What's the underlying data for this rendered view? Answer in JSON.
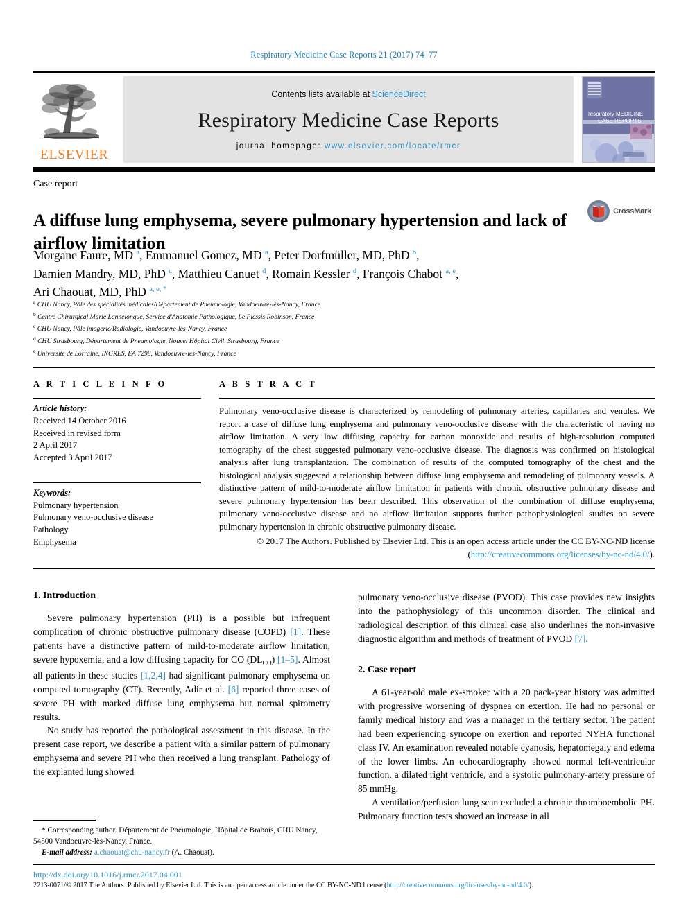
{
  "running_head": "Respiratory Medicine Case Reports 21 (2017) 74–77",
  "masthead": {
    "publisher": "ELSEVIER",
    "contents_prefix": "Contents lists available at ",
    "contents_link": "ScienceDirect",
    "journal_title": "Respiratory Medicine Case Reports",
    "homepage_prefix": "journal homepage: ",
    "homepage_url": "www.elsevier.com/locate/rmcr",
    "cover_line1": "respiratory MEDICINE",
    "cover_line2": "CASE REPORTS"
  },
  "article": {
    "type": "Case report",
    "title": "A diffuse lung emphysema, severe pulmonary hypertension and lack of airflow limitation",
    "crossmark_label": "CrossMark"
  },
  "authors_html": "Morgane Faure, MD <sup>a</sup>, Emmanuel Gomez, MD <sup>a</sup>, Peter Dorfmüller, MD, PhD <sup>b</sup>,<br>Damien Mandry, MD, PhD <sup>c</sup>, Matthieu Canuet <sup>d</sup>, Romain Kessler <sup>d</sup>, François Chabot <sup>a, e</sup>,<br>Ari Chaouat, MD, PhD <sup>a, e, <span class=\"star\">*</span></sup>",
  "affiliations": [
    {
      "mark": "a",
      "text": "CHU Nancy, Pôle des spécialités médicales/Département de Pneumologie, Vandoeuvre-lès-Nancy, France"
    },
    {
      "mark": "b",
      "text": "Centre Chirurgical Marie Lannelongue, Service d'Anatomie Pathologique, Le Plessis Robinson, France"
    },
    {
      "mark": "c",
      "text": "CHU Nancy, Pôle imagerie/Radiologie, Vandoeuvre-lès-Nancy, France"
    },
    {
      "mark": "d",
      "text": "CHU Strasbourg, Département de Pneumologie, Nouvel Hôpital Civil, Strasbourg, France"
    },
    {
      "mark": "e",
      "text": "Université de Lorraine, INGRES, EA 7298, Vandoeuvre-lès-Nancy, France"
    }
  ],
  "article_info": {
    "heading": "A R T I C L E  I N F O",
    "history_label": "Article history:",
    "history_lines": [
      "Received 14 October 2016",
      "Received in revised form",
      "2 April 2017",
      "Accepted 3 April 2017"
    ],
    "keywords_label": "Keywords:",
    "keywords": [
      "Pulmonary hypertension",
      "Pulmonary veno-occlusive disease",
      "Pathology",
      "Emphysema"
    ]
  },
  "abstract": {
    "heading": "A B S T R A C T",
    "text": "Pulmonary veno-occlusive disease is characterized by remodeling of pulmonary arteries, capillaries and venules. We report a case of diffuse lung emphysema and pulmonary veno-occlusive disease with the characteristic of having no airflow limitation. A very low diffusing capacity for carbon monoxide and results of high-resolution computed tomography of the chest suggested pulmonary veno-occlusive disease. The diagnosis was confirmed on histological analysis after lung transplantation. The combination of results of the computed tomography of the chest and the histological analysis suggested a relationship between diffuse lung emphysema and remodeling of pulmonary vessels. A distinctive pattern of mild-to-moderate airflow limitation in patients with chronic obstructive pulmonary disease and severe pulmonary hypertension has been described. This observation of the combination of diffuse emphysema, pulmonary veno-occlusive disease and no airflow limitation supports further pathophysiological studies on severe pulmonary hypertension in chronic obstructive pulmonary disease.",
    "copyright_text": "© 2017 The Authors. Published by Elsevier Ltd. This is an open access article under the CC BY-NC-ND license (",
    "copyright_url": "http://creativecommons.org/licenses/by-nc-nd/4.0/",
    "copyright_suffix": ")."
  },
  "sections": {
    "intro_heading": "1. Introduction",
    "case_heading": "2. Case report"
  },
  "footnote": {
    "star": "*",
    "corresponding": " Corresponding author. Département de Pneumologie, Hôpital de Brabois, CHU Nancy, 54500 Vandoeuvre-lès-Nancy, France.",
    "email_label": "E-mail address:",
    "email": "a.chaouat@chu-nancy.fr",
    "email_suffix": " (A. Chaouat)."
  },
  "bottom": {
    "doi": "http://dx.doi.org/10.1016/j.rmcr.2017.04.001",
    "issn_text": "2213-0071/© 2017 The Authors. Published by Elsevier Ltd. This is an open access article under the CC BY-NC-ND license (",
    "issn_url": "http://creativecommons.org/licenses/by-nc-nd/4.0/",
    "issn_suffix": ")."
  },
  "colors": {
    "link": "#2b91c9",
    "elsevier_orange": "#f07c22",
    "band_gray": "#e3e3e3",
    "cover_purple": "#6b6f9e"
  }
}
